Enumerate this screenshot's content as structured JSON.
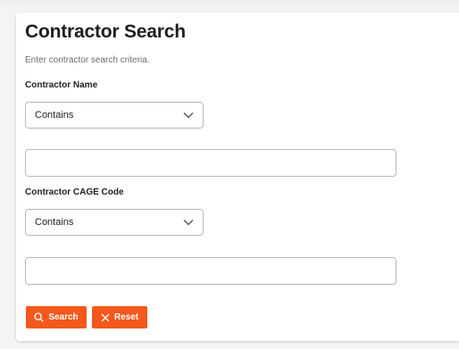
{
  "form": {
    "title": "Contractor Search",
    "subtitle": "Enter contractor search criteria.",
    "contractor_name": {
      "label": "Contractor Name",
      "match_mode": "Contains",
      "value": ""
    },
    "cage_code": {
      "label": "Contractor CAGE Code",
      "match_mode": "Contains",
      "value": ""
    }
  },
  "actions": {
    "search_label": "Search",
    "search_icon": "search-icon",
    "reset_label": "Reset",
    "reset_icon": "close-icon"
  },
  "colors": {
    "accent": "#f4581c"
  }
}
